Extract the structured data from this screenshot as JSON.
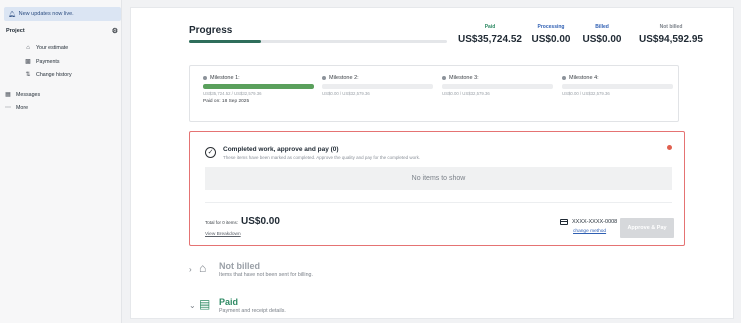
{
  "sidebar": {
    "notice": "New updates now live.",
    "project_label": "Project",
    "items": [
      {
        "label": "Your estimate",
        "icon": "estimate-icon"
      },
      {
        "label": "Payments",
        "icon": "payments-icon"
      },
      {
        "label": "Change history",
        "icon": "history-icon"
      }
    ],
    "messages_label": "Messages",
    "more_label": "More"
  },
  "progress": {
    "title": "Progress",
    "fraction": 0.28,
    "paid_label": "Paid",
    "paid_value": "US$35,724.52",
    "processing_label": "Processing",
    "processing_value": "US$0.00",
    "billed_label": "Billed",
    "billed_value": "US$0.00",
    "not_billed_label": "Not billed",
    "not_billed_value": "US$94,592.95",
    "colors": {
      "paid": "#2e8a64",
      "processing": "#2f5fb3",
      "billed": "#2f5fb3",
      "not_billed": "#7b8189"
    }
  },
  "milestones": [
    {
      "title": "Milestone 1:",
      "amount": "US$35,724.52 / US$32,579.36",
      "fraction": 1.0,
      "paid_on": "Paid on: 18 Sep 2025"
    },
    {
      "title": "Milestone 2:",
      "amount": "US$0.00 / US$32,579.36",
      "fraction": 0
    },
    {
      "title": "Milestone 3:",
      "amount": "US$0.00 / US$32,579.36",
      "fraction": 0
    },
    {
      "title": "Milestone 4:",
      "amount": "US$0.00 / US$32,579.36",
      "fraction": 0
    }
  ],
  "work": {
    "title": "Completed work, approve and pay (0)",
    "subtitle": "These items have been marked as completed. Approve the quality and pay for the completed work.",
    "empty": "No items to show",
    "total_label": "Total for 0 items:",
    "total_value": "US$0.00",
    "breakdown": "View Breakdown",
    "card": "XXXX-XXXX-0008",
    "change_method": "change method",
    "approve": "Approve & Pay"
  },
  "not_billed": {
    "title": "Not billed",
    "subtitle": "Items that have not been sent for billing."
  },
  "paid": {
    "title": "Paid",
    "subtitle": "Payment and receipt details."
  }
}
